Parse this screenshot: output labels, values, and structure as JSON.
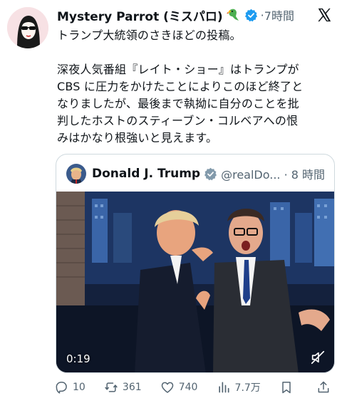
{
  "tweet": {
    "author_name": "Mystery Parrot (ミスパロ)",
    "separator": " ·",
    "time": "7時間",
    "text": "トランプ大統領のさきほどの投稿。\n\n深夜人気番組『レイト・ショー』はトランプが\nCBS に圧力をかけたことによりこのほど終了と\nなりましたが、最後まで執拗に自分のことを批\n判したホストのスティーブン・コルベアへの恨\nみはかなり根強いと見えます。"
  },
  "quote": {
    "author_name": "Donald J. Trump",
    "handle_time": "@realDo... · 8 時間",
    "video_duration": "0:19"
  },
  "actions": {
    "replies": "10",
    "reposts": "361",
    "likes": "740",
    "views": "7.7万"
  },
  "colors": {
    "verified": "#1d9bf0",
    "text_secondary": "#536471",
    "border": "#cfd9de"
  },
  "icons": [
    "parrot-emoji",
    "verified-badge-icon",
    "x-logo-icon",
    "mute-icon",
    "reply-icon",
    "repost-icon",
    "like-icon",
    "views-icon",
    "bookmark-icon",
    "share-icon"
  ]
}
